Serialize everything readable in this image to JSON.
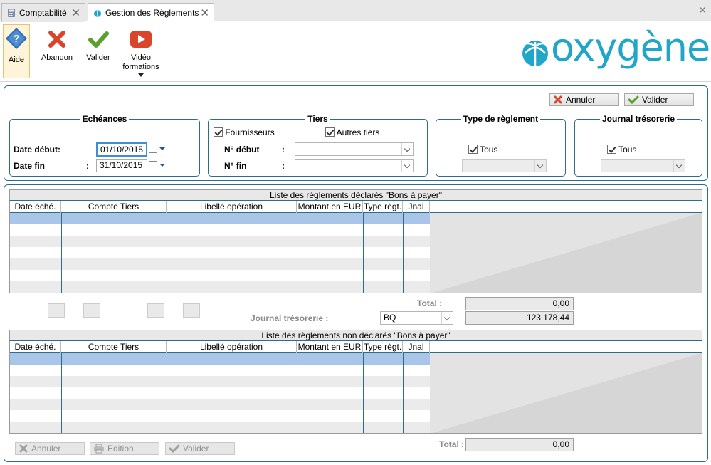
{
  "tabs": [
    {
      "label": "Comptabilité"
    },
    {
      "label": "Gestion des Règlements"
    }
  ],
  "toolbar": {
    "help": "Aide",
    "abandon": "Abandon",
    "validate": "Valider",
    "video": "Vidéo formations"
  },
  "logo": "oxygène",
  "top_actions": {
    "cancel": "Annuler",
    "validate": "Valider"
  },
  "echeances": {
    "title": "Echéances",
    "start_label": "Date début",
    "start_value": "01/10/2015",
    "end_label": "Date fin",
    "end_value": "31/10/2015",
    "colon": ":"
  },
  "tiers": {
    "title": "Tiers",
    "suppliers": "Fournisseurs",
    "suppliers_checked": true,
    "others": "Autres tiers",
    "others_checked": true,
    "start_label": "N° début",
    "end_label": "N° fin",
    "colon": ":"
  },
  "type_reglement": {
    "title": "Type de règlement",
    "all": "Tous",
    "checked": true
  },
  "journal_tresorerie": {
    "title": "Journal trésorerie",
    "all": "Tous",
    "checked": true
  },
  "grid1": {
    "title": "Liste des règlements déclarés \"Bons à payer\"",
    "columns": [
      "Date éché.",
      "Compte Tiers",
      "Libellé opération",
      "Montant en EUR",
      "Type règt.",
      "Jnal"
    ]
  },
  "summary": {
    "total_label": "Total :",
    "total_value": "0,00",
    "journal_label": "Journal trésorerie :",
    "journal_value": "BQ",
    "balance_value": "123 178,44"
  },
  "grid2": {
    "title": "Liste des règlements non déclarés \"Bons à payer\"",
    "columns": [
      "Date éché.",
      "Compte Tiers",
      "Libellé opération",
      "Montant en EUR",
      "Type règt.",
      "Jnal"
    ]
  },
  "bottom": {
    "cancel": "Annuler",
    "edition": "Edition",
    "validate": "Valider",
    "total_label": "Total :",
    "total_value": "0,00"
  },
  "colors": {
    "accent": "#2e6d8a",
    "logo": "#1fa6c9",
    "selected_row": "#a9c6e8",
    "cancel": "#d9442a",
    "ok": "#5aa02c"
  }
}
